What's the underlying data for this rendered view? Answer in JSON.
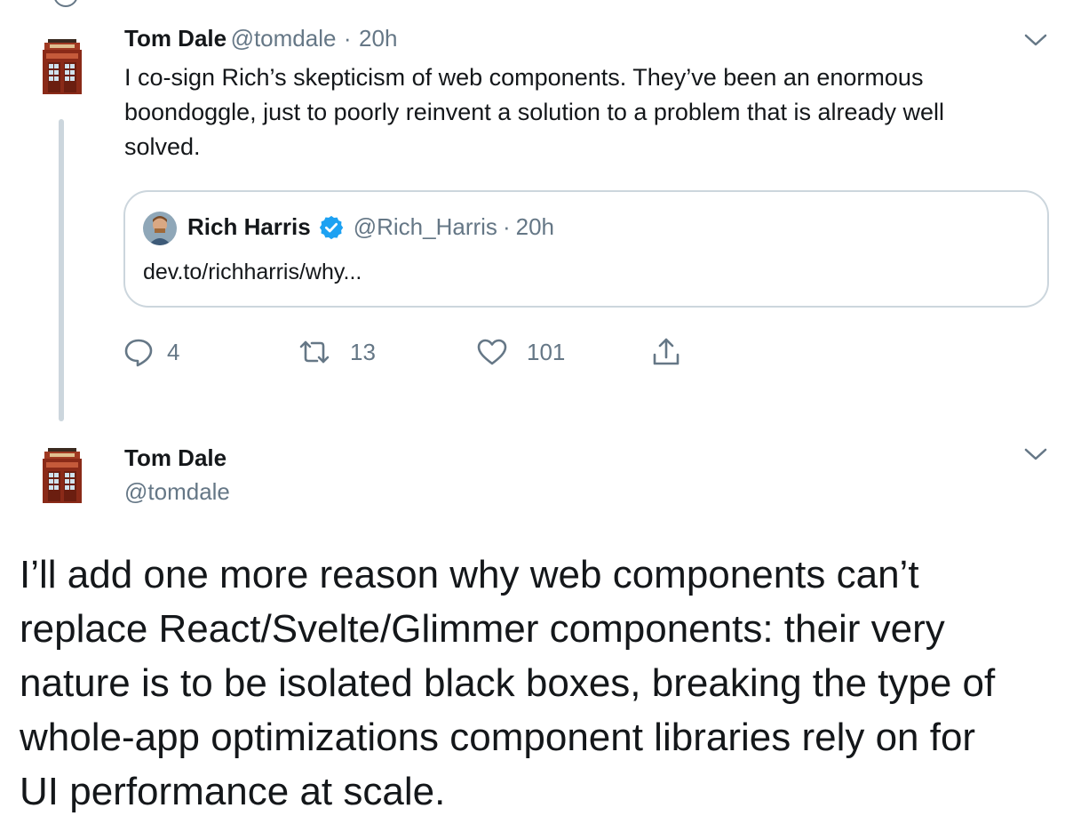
{
  "tweet": {
    "author_name": "Tom Dale",
    "author_handle": "@tomdale",
    "separator": "·",
    "time": "20h",
    "text_lines": [
      "I co-sign Rich’s skepticism of web components. They’ve been an enormous",
      "boondoggle, just to poorly reinvent a solution to a problem that is already well",
      "solved."
    ],
    "quote": {
      "author_name": "Rich Harris",
      "author_handle": "@Rich_Harris",
      "separator": "·",
      "time": "20h",
      "link_text": "dev.to/richharris/why..."
    },
    "actions": {
      "reply_count": "4",
      "retweet_count": "13",
      "like_count": "101"
    }
  },
  "main_tweet": {
    "author_name": "Tom Dale",
    "author_handle": "@tomdale",
    "text_lines": [
      "I’ll add one more reason why web components can’t",
      "replace React/Svelte/Glimmer components: their very",
      "nature is to be isolated black boxes, breaking the type of",
      "whole-app optimizations component libraries rely on for",
      "UI performance at scale."
    ]
  },
  "icons": [
    "avatar-phonebooth-icon",
    "chevron-down-icon",
    "verified-badge-icon",
    "reply-icon",
    "retweet-icon",
    "like-icon",
    "share-icon"
  ],
  "colors": {
    "text": "#14171a",
    "secondary": "#657786",
    "border": "#ccd6dd",
    "verified": "#1da1f2"
  }
}
